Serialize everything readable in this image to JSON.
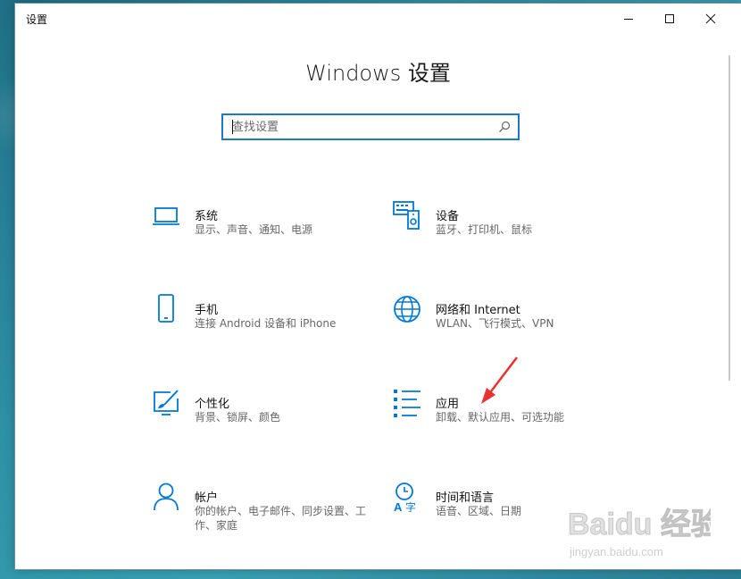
{
  "window": {
    "title": "设置",
    "heading": "Windows 设置"
  },
  "search": {
    "placeholder": "查找设置"
  },
  "tiles": [
    {
      "name": "系统",
      "desc": "显示、声音、通知、电源",
      "icon": "laptop-icon"
    },
    {
      "name": "设备",
      "desc": "蓝牙、打印机、鼠标",
      "icon": "keyboard-device-icon"
    },
    {
      "name": "手机",
      "desc": "连接 Android 设备和 iPhone",
      "icon": "phone-icon"
    },
    {
      "name": "网络和 Internet",
      "desc": "WLAN、飞行模式、VPN",
      "icon": "globe-icon"
    },
    {
      "name": "个性化",
      "desc": "背景、锁屏、颜色",
      "icon": "paint-brush-icon"
    },
    {
      "name": "应用",
      "desc": "卸载、默认应用、可选功能",
      "icon": "apps-list-icon"
    },
    {
      "name": "帐户",
      "desc": "你的帐户、电子邮件、同步设置、工作、家庭",
      "icon": "person-icon"
    },
    {
      "name": "时间和语言",
      "desc": "语音、区域、日期",
      "icon": "time-language-icon"
    }
  ],
  "watermark": {
    "brand": "Baidu 经验",
    "url": "jingyan.baidu.com"
  },
  "colors": {
    "accent": "#0078d7",
    "annotation_arrow": "#e8322f"
  }
}
